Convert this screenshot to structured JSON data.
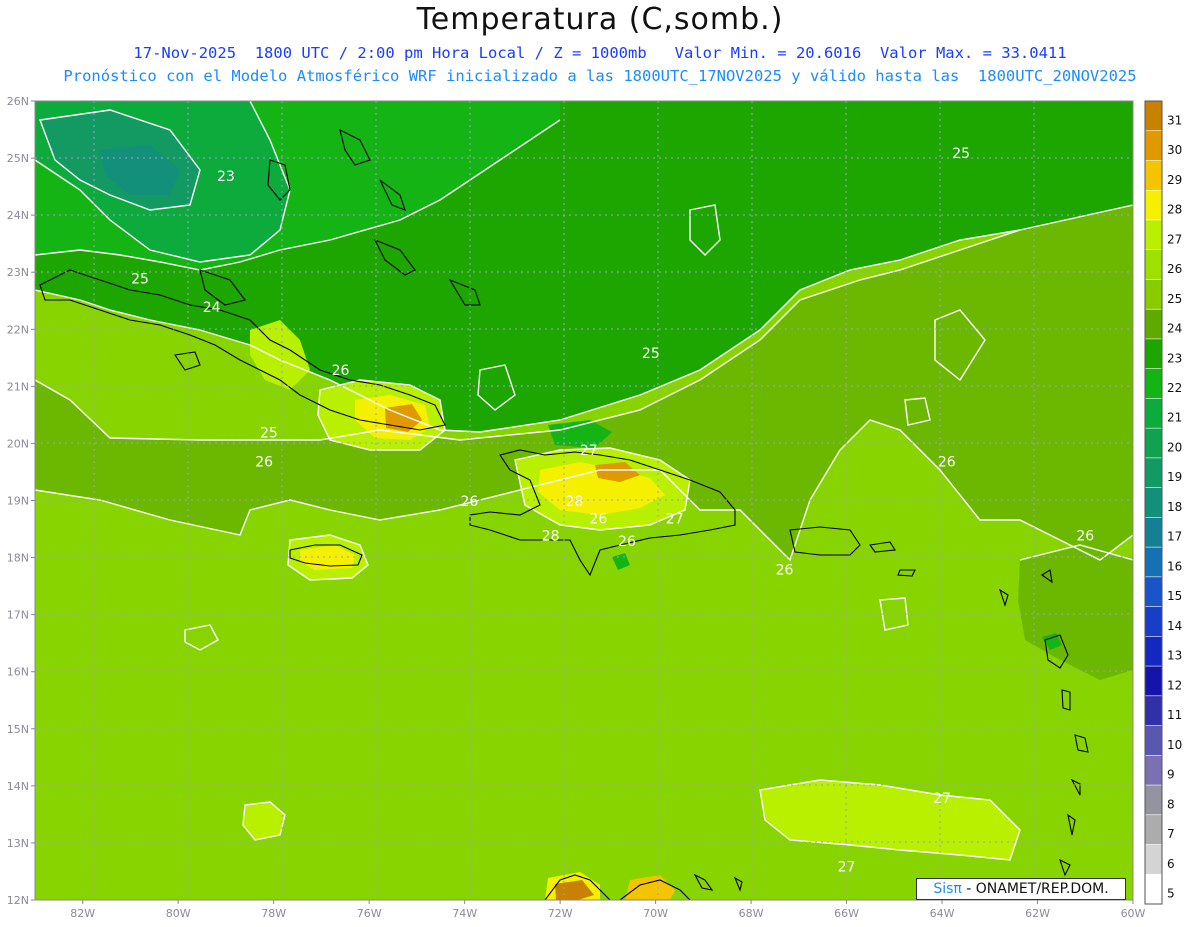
{
  "header": {
    "title": "Temperatura (C,somb.)",
    "line1": "17-Nov-2025  1800 UTC / 2:00 pm Hora Local / Z = 1000mb   Valor Min. = 20.6016  Valor Max. = 33.0411",
    "line2": "Pronóstico con el Modelo Atmosférico WRF inicializado a las 1800UTC_17NOV2025 y válido hasta las  1800UTC_20NOV2025"
  },
  "map": {
    "lat_labels": [
      "26N",
      "25N",
      "24N",
      "23N",
      "22N",
      "21N",
      "20N",
      "19N",
      "18N",
      "17N",
      "16N",
      "15N",
      "14N",
      "13N",
      "12N"
    ],
    "lon_labels": [
      "82W",
      "80W",
      "78W",
      "76W",
      "74W",
      "72W",
      "70W",
      "68W",
      "66W",
      "64W",
      "62W",
      "60W"
    ],
    "contour_labels": [
      {
        "text": "23",
        "lat": 24.6,
        "lon": -79.0
      },
      {
        "text": "25",
        "lat": 22.8,
        "lon": -80.8
      },
      {
        "text": "24",
        "lat": 22.3,
        "lon": -79.3
      },
      {
        "text": "26",
        "lat": 21.2,
        "lon": -76.6
      },
      {
        "text": "25",
        "lat": 20.1,
        "lon": -78.1
      },
      {
        "text": "26",
        "lat": 19.6,
        "lon": -78.2
      },
      {
        "text": "26",
        "lat": 18.9,
        "lon": -73.9
      },
      {
        "text": "25",
        "lat": 21.5,
        "lon": -70.1
      },
      {
        "text": "25",
        "lat": 25.0,
        "lon": -63.6
      },
      {
        "text": "26",
        "lat": 19.6,
        "lon": -63.9
      },
      {
        "text": "27",
        "lat": 19.8,
        "lon": -71.4
      },
      {
        "text": "28",
        "lat": 18.9,
        "lon": -71.7
      },
      {
        "text": "26",
        "lat": 18.6,
        "lon": -71.2
      },
      {
        "text": "28",
        "lat": 18.3,
        "lon": -72.2
      },
      {
        "text": "26",
        "lat": 18.2,
        "lon": -70.6
      },
      {
        "text": "27",
        "lat": 18.6,
        "lon": -69.6
      },
      {
        "text": "26",
        "lat": 17.7,
        "lon": -67.3
      },
      {
        "text": "26",
        "lat": 18.3,
        "lon": -61.0
      },
      {
        "text": "27",
        "lat": 13.7,
        "lon": -64.0
      },
      {
        "text": "27",
        "lat": 12.5,
        "lon": -66.0
      }
    ]
  },
  "colorbar": {
    "labels": [
      "31",
      "30",
      "29",
      "28",
      "27",
      "26",
      "25",
      "24",
      "23",
      "22",
      "21",
      "20",
      "19",
      "18",
      "17",
      "16",
      "15",
      "14",
      "13",
      "12",
      "11",
      "10",
      "9",
      "8",
      "7",
      "6",
      "5"
    ],
    "colors": [
      "#c88200",
      "#e09a00",
      "#f5c400",
      "#f5f000",
      "#b8f000",
      "#9ee000",
      "#88cc00",
      "#60aa00",
      "#1ea600",
      "#14b414",
      "#0cab3c",
      "#10a24e",
      "#129a62",
      "#139079",
      "#148095",
      "#1870b4",
      "#1a55c8",
      "#163ec8",
      "#1428c0",
      "#1414aa",
      "#3030a8",
      "#5858b0",
      "#7c70b4",
      "#9494a0",
      "#acacac",
      "#d4d4d4",
      "#ffffff"
    ]
  },
  "credits": {
    "brand": "Sisπ",
    "text": " - ONAMET/REP.DOM."
  }
}
